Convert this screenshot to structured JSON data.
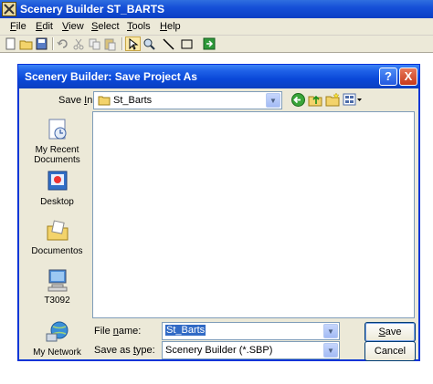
{
  "app": {
    "title": "Scenery Builder  ST_BARTS",
    "menu": [
      {
        "label": "File",
        "u": "F",
        "rest": "ile"
      },
      {
        "label": "Edit",
        "u": "E",
        "rest": "dit"
      },
      {
        "label": "View",
        "u": "V",
        "rest": "iew"
      },
      {
        "label": "Select",
        "u": "S",
        "rest": "elect"
      },
      {
        "label": "Tools",
        "u": "T",
        "rest": "ools"
      },
      {
        "label": "Help",
        "u": "H",
        "rest": "elp"
      }
    ],
    "toolbar_icons": [
      "new-file-icon",
      "open-folder-icon",
      "save-icon",
      "undo-icon",
      "cut-icon",
      "copy-icon",
      "paste-icon",
      "select-arrow-icon",
      "zoom-icon",
      "line-tool-icon",
      "rectangle-tool-icon",
      "export-icon"
    ]
  },
  "dialog": {
    "title": "Scenery Builder: Save Project As",
    "help_button": "?",
    "close_button": "X",
    "save_in_label_u": "I",
    "save_in_label_pre": "Save ",
    "save_in_label_post": "n:",
    "save_in_value": "St_Barts",
    "places": [
      {
        "label_line1": "My Recent",
        "label_line2": "Documents",
        "icon": "recent-documents-icon"
      },
      {
        "label_line1": "Desktop",
        "label_line2": "",
        "icon": "desktop-icon"
      },
      {
        "label_line1": "Documentos",
        "label_line2": "",
        "icon": "documents-folder-icon"
      },
      {
        "label_line1": "T3092",
        "label_line2": "",
        "icon": "my-computer-icon"
      },
      {
        "label_line1": "My Network",
        "label_line2": "",
        "icon": "network-icon"
      }
    ],
    "file_name_label_pre": "File ",
    "file_name_label_u": "n",
    "file_name_label_post": "ame:",
    "file_name_value": "St_Barts",
    "save_as_type_label_pre": "Save as ",
    "save_as_type_label_u": "t",
    "save_as_type_label_post": "ype:",
    "save_as_type_value": "Scenery Builder (*.SBP)",
    "save_button_u": "S",
    "save_button_rest": "ave",
    "cancel_button": "Cancel"
  }
}
